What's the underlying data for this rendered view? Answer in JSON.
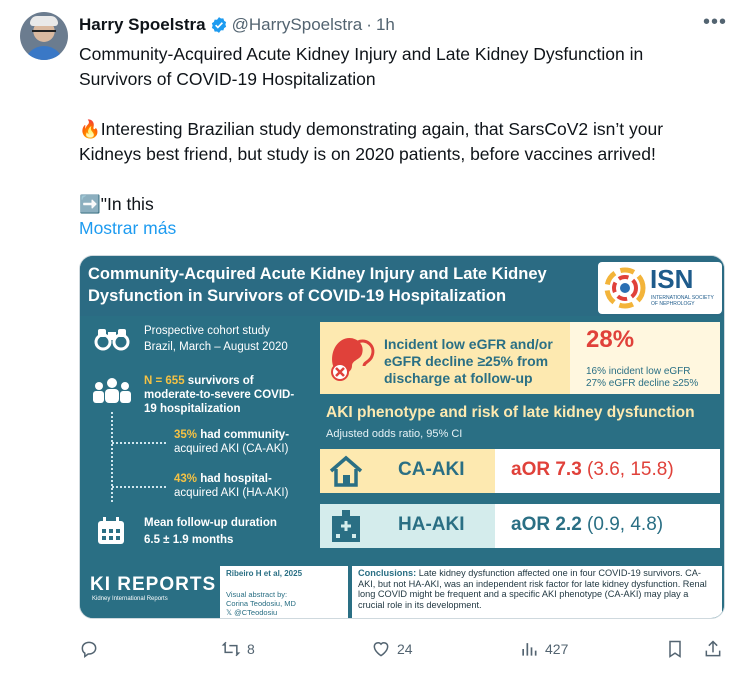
{
  "tweet": {
    "display_name": "Harry Spoelstra",
    "handle": "@HarrySpoelstra",
    "separator": "·",
    "time": "1h",
    "more_icon": "more-horizontal-icon",
    "text_lines": [
      "Community-Acquired Acute Kidney Injury and Late Kidney Dysfunction in",
      "Survivors of COVID-19 Hospitalization",
      "",
      "🔥Interesting Brazilian study demonstrating again, that SarsCoV2 isn’t your",
      "Kidneys best friend, but study is on 2020 patients, before vaccines arrived!",
      "",
      "➡️\"In this"
    ],
    "show_more": "Mostrar más"
  },
  "card": {
    "title_line1": "Community-Acquired Acute Kidney Injury and Late Kidney",
    "title_line2": "Dysfunction in Survivors of COVID-19 Hospitalization",
    "isn": "ISN",
    "isn_sub": "INTERNATIONAL SOCIETY OF NEPHROLOGY",
    "left": {
      "study": "Prospective cohort study",
      "place": "Brazil, March – August 2020",
      "n_bold": "N = 655",
      "n_rest1": " survivors of",
      "n_rest2": "moderate-to-severe COVID-",
      "n_rest3": "19 hospitalization",
      "ca_pct": "35%",
      "ca_text1": " had community-",
      "ca_text2": "acquired AKI (CA-AKI)",
      "ha_pct": "43%",
      "ha_text1": " had hospital-",
      "ha_text2": "acquired AKI (HA-AKI)",
      "fu1": "Mean follow-up duration",
      "fu2": "6.5 ± 1.9 months"
    },
    "incident": {
      "line1": "Incident low eGFR and/or",
      "line2": "eGFR decline ≥25% from",
      "line3": "discharge at follow-up",
      "pct": "28%",
      "sub1": "16% incident low eGFR",
      "sub2": "27% eGFR decline ≥25%"
    },
    "aki": {
      "title": "AKI phenotype and risk of late kidney dysfunction",
      "sub": "Adjusted odds ratio, 95% CI",
      "ca_label": "CA-AKI",
      "ca_aor": "aOR 7.3",
      "ca_ci": " (3.6, 15.8)",
      "ha_label": "HA-AKI",
      "ha_aor": "aOR 2.2",
      "ha_ci": " (0.9, 4.8)"
    },
    "footer": {
      "ki": "KI REPORTS",
      "ki_sub": "Kidney International Reports",
      "citation": "Ribeiro H et al, 2025",
      "visual_by": "Visual abstract by:",
      "artist": "Corina Teodosiu, MD",
      "artist_handle": "@CTeodosiu",
      "concl_label": "Conclusions:",
      "concl_text": " Late kidney dysfunction affected one in four COVID-19 survivors. CA-AKI, but not HA-AKI, was an independent risk factor for late kidney dysfunction. Renal long COVID might be frequent and a specific AKI phenotype (CA-AKI) may play a crucial role in its development."
    }
  },
  "actions": {
    "reply_count": "",
    "retweet_count": "8",
    "like_count": "24",
    "views_count": "427"
  },
  "colors": {
    "link": "#1d9bf0",
    "verified": "#1d9bf0",
    "teal": "#2a6f84",
    "red": "#e0413a"
  }
}
